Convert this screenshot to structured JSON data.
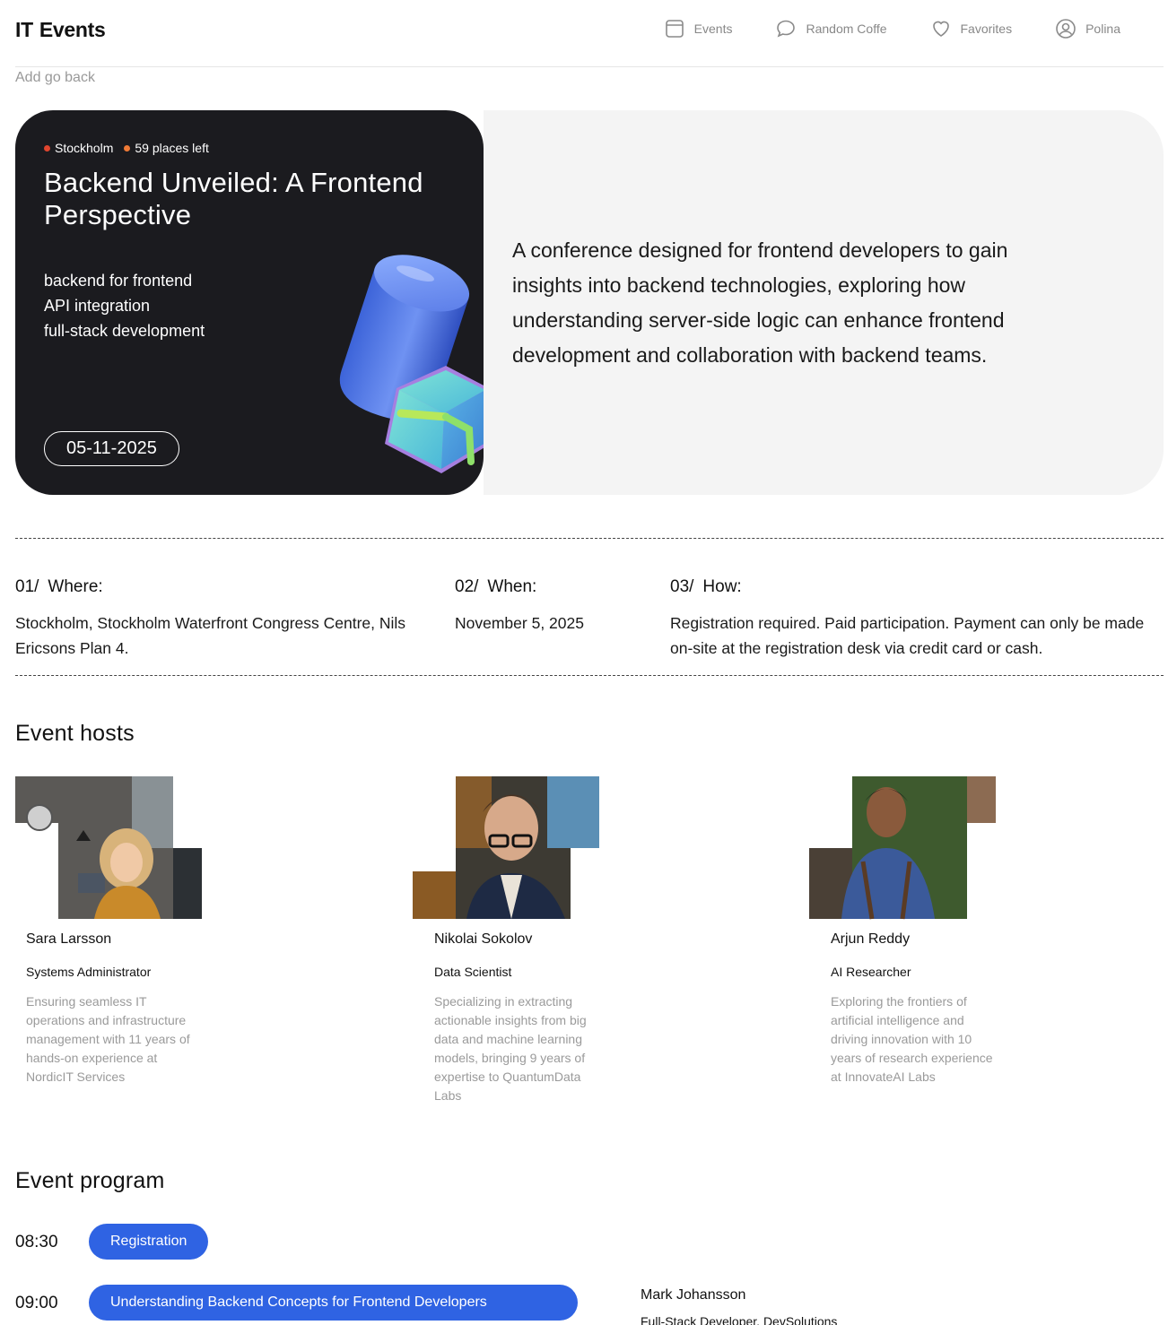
{
  "header": {
    "logo_it": "IT",
    "logo_events": "Events",
    "nav": [
      {
        "label": "Events",
        "icon": "calendar-icon"
      },
      {
        "label": "Random Coffe",
        "icon": "chat-bubble-icon"
      },
      {
        "label": "Favorites",
        "icon": "heart-icon"
      },
      {
        "label": "Polina",
        "icon": "user-circle-icon"
      }
    ]
  },
  "back_link": "Add go back",
  "event": {
    "city": "Stockholm",
    "places": "59 places left",
    "title": "Backend Unveiled: A Frontend Perspective",
    "tags": [
      "backend for frontend",
      "API integration",
      "full-stack development"
    ],
    "date": "05-11-2025",
    "description": "A conference designed for frontend developers to gain insights into backend technologies, exploring how understanding server-side logic can enhance frontend development and collaboration with backend teams."
  },
  "info": [
    {
      "num": "01/",
      "label": "Where:",
      "text": "Stockholm, Stockholm Waterfront Congress Centre, Nils Ericsons Plan 4."
    },
    {
      "num": "02/",
      "label": "When:",
      "text": "November 5, 2025"
    },
    {
      "num": "03/",
      "label": "How:",
      "text": "Registration required. Paid participation. Payment can only be made on-site at the registration desk via credit card or cash."
    }
  ],
  "hosts_title": "Event hosts",
  "hosts": [
    {
      "first": "Sara",
      "last": "Larsson",
      "role": "Systems Administrator",
      "bio": "Ensuring seamless IT operations and infrastructure management with 11 years of hands-on experience at NordicIT Services"
    },
    {
      "first": "Nikolai",
      "last": "Sokolov",
      "role": "Data Scientist",
      "bio": "Specializing in extracting actionable insights from big data and machine learning models, bringing 9 years of expertise to QuantumData Labs"
    },
    {
      "first": "Arjun",
      "last": "Reddy",
      "role": "AI Researcher",
      "bio": "Exploring the frontiers of artificial intelligence and driving innovation with 10 years of research experience at InnovateAI Labs"
    }
  ],
  "program_title": "Event program",
  "program": [
    {
      "time": "08:30",
      "title": "Registration"
    },
    {
      "time": "09:00",
      "title": "Understanding Backend Concepts for Frontend Developers",
      "speaker": "Mark Johansson",
      "speaker_role": "Full-Stack Developer, DevSolutions"
    }
  ],
  "colors": {
    "accent_blue": "#2f63e3",
    "logo_yellow": "#f7d358",
    "hero_dark": "#1b1b1f",
    "city_dot": "#e0452e",
    "places_dot": "#ef7a36"
  }
}
